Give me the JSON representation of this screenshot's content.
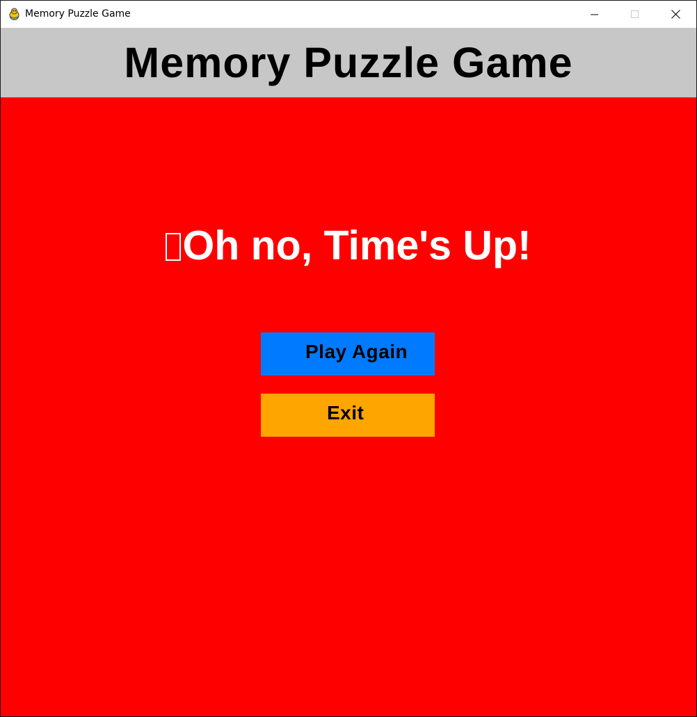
{
  "window": {
    "title": "Memory Puzzle Game",
    "app_icon": "pygame-snake-icon",
    "controls": [
      "minimize-icon",
      "maximize-icon",
      "close-icon"
    ]
  },
  "header": {
    "title": "Memory Puzzle Game",
    "background": "#c7c7c7"
  },
  "game": {
    "background": "#ff0000",
    "message": "Oh no, Time's Up!",
    "message_color": "#ffffff",
    "message_glyph": "missing-glyph-box-icon",
    "buttons": {
      "play_again": {
        "label": "Play Again",
        "color": "#007bff"
      },
      "exit": {
        "label": "Exit",
        "color": "#ffa500"
      }
    }
  }
}
